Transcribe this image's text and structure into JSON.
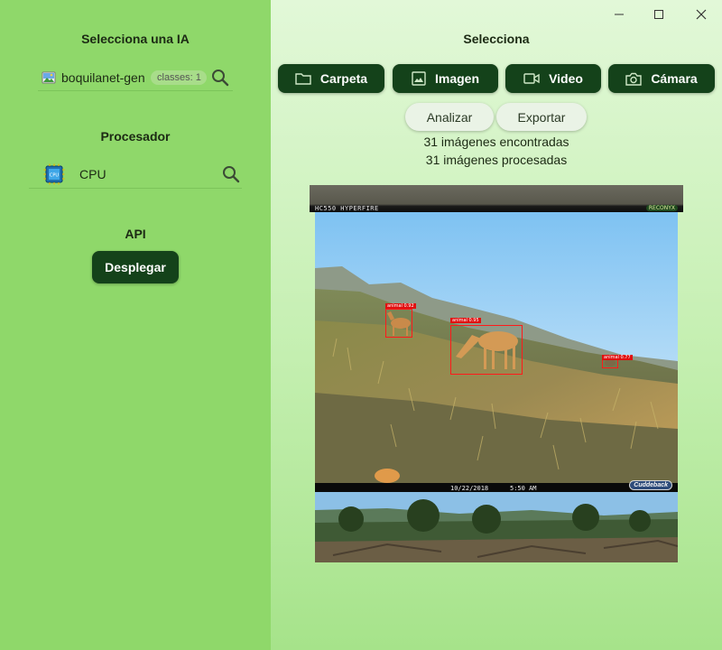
{
  "left_panel": {
    "model_title": "Selecciona una IA",
    "model_name": "boquilanet-gen",
    "model_chip": "classes: 1",
    "processor_title": "Procesador",
    "processor_name": "CPU",
    "api_title": "API",
    "deploy_label": "Desplegar"
  },
  "main": {
    "title": "Selecciona",
    "toolbar": [
      {
        "label": "Carpeta",
        "icon": "folder-icon"
      },
      {
        "label": "Imagen",
        "icon": "image-icon"
      },
      {
        "label": "Video",
        "icon": "video-icon"
      },
      {
        "label": "Cámara",
        "icon": "camera-icon"
      }
    ],
    "analyze_label": "Analizar",
    "export_label": "Exportar",
    "found_text": "31 imágenes encontradas",
    "processed_text": "31 imágenes procesadas"
  },
  "preview": {
    "top_strip_caption": "HC550 HYPERFIRE",
    "top_strip_brand": "RECONYX",
    "main_date": "10/22/2018",
    "main_time": "5:50 AM",
    "main_brand": "Cuddeback",
    "detections": [
      {
        "label": "animal 0.92"
      },
      {
        "label": "animal 0.95"
      },
      {
        "label": "animal 0.77"
      }
    ]
  },
  "colors": {
    "left_bg": "#8fd86a",
    "button_dark": "#14421a",
    "detection_box": "#ff1a1a"
  }
}
